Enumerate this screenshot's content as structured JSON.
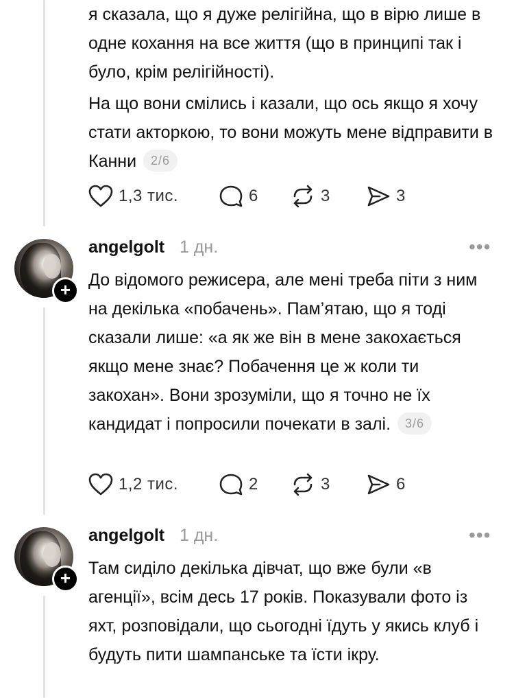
{
  "posts": [
    {
      "paragraphs": [
        "я сказала, що я дуже релігійна, що в вірю лише в одне кохання на все життя (що в принципі так і було, крім релігійності).",
        "На що вони смілись і казали, що ось якщо я хочу стати акторкою, то вони можуть мене відправити в Канни"
      ],
      "counter": "2/6",
      "likes": "1,3 тис.",
      "replies": "6",
      "reposts": "3",
      "shares": "3"
    },
    {
      "username": "angelgolt",
      "time": "1 дн.",
      "paragraphs": [
        "До відомого режисера, але мені треба піти з ним на декілька «побачень». Пам’ятаю, що я тоді сказали лише: «а як же він в мене закохається якщо мене знає? Побачення це ж коли ти закохан». Вони зрозуміли, що я точно не їх кандидат і попросили почекати в залі."
      ],
      "counter": "3/6",
      "likes": "1,2 тис.",
      "replies": "2",
      "reposts": "3",
      "shares": "6"
    },
    {
      "username": "angelgolt",
      "time": "1 дн.",
      "paragraphs": [
        "Там сиділо декілька дівчат, що вже були «в агенції», всім десь 17 років. Показували фото із яхт, розповідали, що сьогодні їдуть у якись клуб і будуть пити шампанське та їсти ікру."
      ]
    }
  ],
  "icons": {
    "like": "heart-icon",
    "reply": "comment-bubble-icon",
    "repost": "repost-arrows-icon",
    "share": "send-icon",
    "more": "more-dots-icon",
    "follow": "plus-icon"
  },
  "colors": {
    "text": "#111111",
    "muted": "#999999",
    "thread_line": "#e3e3e3",
    "counter_bg": "#f1f1f1"
  }
}
